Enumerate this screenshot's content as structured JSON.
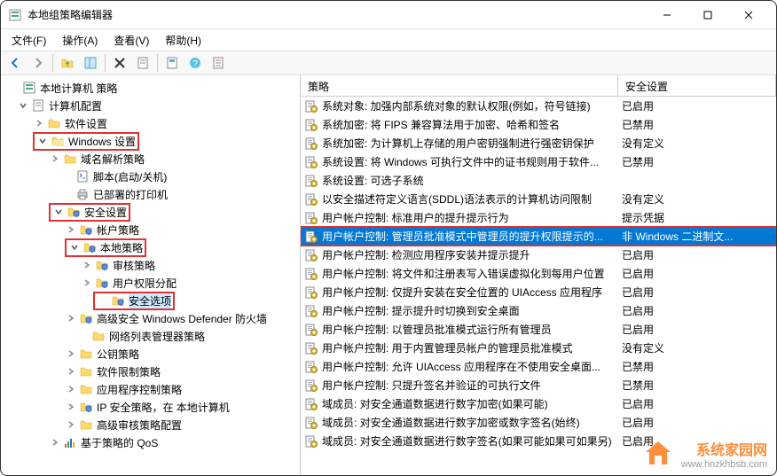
{
  "window": {
    "title": "本地组策略编辑器"
  },
  "menu": {
    "file": "文件(F)",
    "action": "操作(A)",
    "view": "查看(V)",
    "help": "帮助(H)"
  },
  "tree": {
    "root": "本地计算机 策略",
    "computer_config": "计算机配置",
    "software_settings": "软件设置",
    "windows_settings": "Windows 设置",
    "dns_policy": "域名解析策略",
    "scripts": "脚本(启动/关机)",
    "printers": "已部署的打印机",
    "security_settings": "安全设置",
    "account_policies": "帐户策略",
    "local_policies": "本地策略",
    "audit_policy": "审核策略",
    "user_rights": "用户权限分配",
    "security_options": "安全选项",
    "defender": "高级安全 Windows Defender 防火墙",
    "network_list": "网络列表管理器策略",
    "public_key": "公钥策略",
    "software_restrict": "软件限制策略",
    "app_control": "应用程序控制策略",
    "ip_security": "IP 安全策略，在 本地计算机",
    "advanced_audit": "高级审核策略配置",
    "qos": "基于策略的 QoS"
  },
  "columns": {
    "policy": "策略",
    "setting": "安全设置"
  },
  "rows": [
    {
      "policy": "系统对象: 加强内部系统对象的默认权限(例如，符号链接)",
      "setting": "已启用"
    },
    {
      "policy": "系统加密: 将 FIPS 兼容算法用于加密、哈希和签名",
      "setting": "已禁用"
    },
    {
      "policy": "系统加密: 为计算机上存储的用户密钥强制进行强密钥保护",
      "setting": "没有定义"
    },
    {
      "policy": "系统设置: 将 Windows 可执行文件中的证书规则用于软件...",
      "setting": "已禁用"
    },
    {
      "policy": "系统设置: 可选子系统",
      "setting": ""
    },
    {
      "policy": "以安全描述符定义语言(SDDL)语法表示的计算机访问限制",
      "setting": "没有定义"
    },
    {
      "policy": "用户帐户控制: 标准用户的提升提示行为",
      "setting": "提示凭据"
    },
    {
      "policy": "用户帐户控制: 管理员批准模式中管理员的提升权限提示的...",
      "setting": "非 Windows 二进制文...",
      "selected": true
    },
    {
      "policy": "用户帐户控制: 检测应用程序安装并提示提升",
      "setting": "已启用"
    },
    {
      "policy": "用户帐户控制: 将文件和注册表写入错误虚拟化到每用户位置",
      "setting": "已启用"
    },
    {
      "policy": "用户帐户控制: 仅提升安装在安全位置的 UIAccess 应用程序",
      "setting": "已启用"
    },
    {
      "policy": "用户帐户控制: 提示提升时切换到安全桌面",
      "setting": "已启用"
    },
    {
      "policy": "用户帐户控制: 以管理员批准模式运行所有管理员",
      "setting": "已启用"
    },
    {
      "policy": "用户帐户控制: 用于内置管理员帐户的管理员批准模式",
      "setting": "没有定义"
    },
    {
      "policy": "用户帐户控制: 允许 UIAccess 应用程序在不使用安全桌面...",
      "setting": "已禁用"
    },
    {
      "policy": "用户帐户控制: 只提升签名并验证的可执行文件",
      "setting": "已禁用"
    },
    {
      "policy": "域成员: 对安全通道数据进行数字加密(如果可能)",
      "setting": "已启用"
    },
    {
      "policy": "域成员: 对安全通道数据进行数字加密或数字签名(始终)",
      "setting": "已启用"
    },
    {
      "policy": "域成员: 对安全通道数据进行数字签名(如果可能如果可如果另)",
      "setting": "已启用"
    }
  ],
  "watermark": {
    "title": "系统家园网",
    "url": "www.hnzkhbsb.com"
  }
}
